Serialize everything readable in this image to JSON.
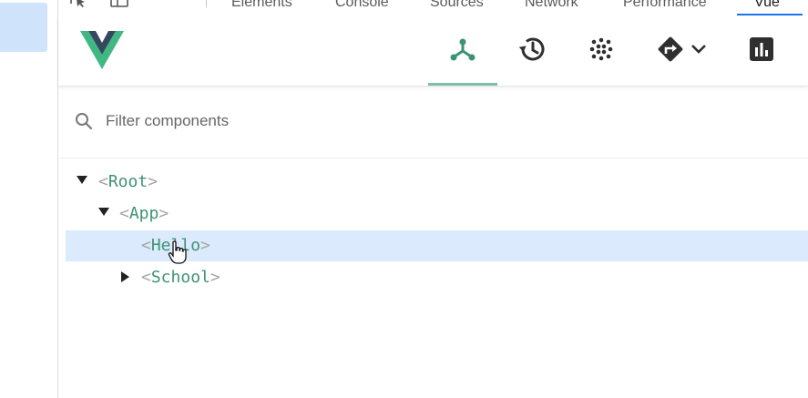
{
  "devtools_tabs": [
    "Elements",
    "Console",
    "Sources",
    "Network",
    "Performance",
    "Vue"
  ],
  "devtools_overflow": "»",
  "vue_header": {
    "logo": "vue-logo",
    "tabs": [
      {
        "name": "components",
        "icon": "component-tree-icon",
        "active": true
      },
      {
        "name": "timeline",
        "icon": "history-icon",
        "active": false
      },
      {
        "name": "vuex",
        "icon": "vuex-dots-icon",
        "active": false
      },
      {
        "name": "routing",
        "icon": "route-diamond-icon",
        "active": false,
        "has_dropdown": true
      },
      {
        "name": "performance",
        "icon": "bar-chart-icon",
        "active": false
      }
    ],
    "accent_color": "#7bbfa5"
  },
  "filter": {
    "placeholder": "Filter components",
    "value": ""
  },
  "tree": {
    "open_bracket": "<",
    "close_bracket": ">",
    "nodes": [
      {
        "name": "Root",
        "depth": 0,
        "expanded": true,
        "selected": false
      },
      {
        "name": "App",
        "depth": 1,
        "expanded": true,
        "selected": false
      },
      {
        "name": "Hello",
        "depth": 2,
        "expanded": null,
        "selected": true
      },
      {
        "name": "School",
        "depth": 2,
        "expanded": false,
        "selected": false
      }
    ]
  },
  "colors": {
    "tag_name": "#3e9274",
    "bracket": "#a6a6a6",
    "selected_row": "#dbeafc",
    "vue_green": "#41b883",
    "vue_dark": "#34495e"
  }
}
